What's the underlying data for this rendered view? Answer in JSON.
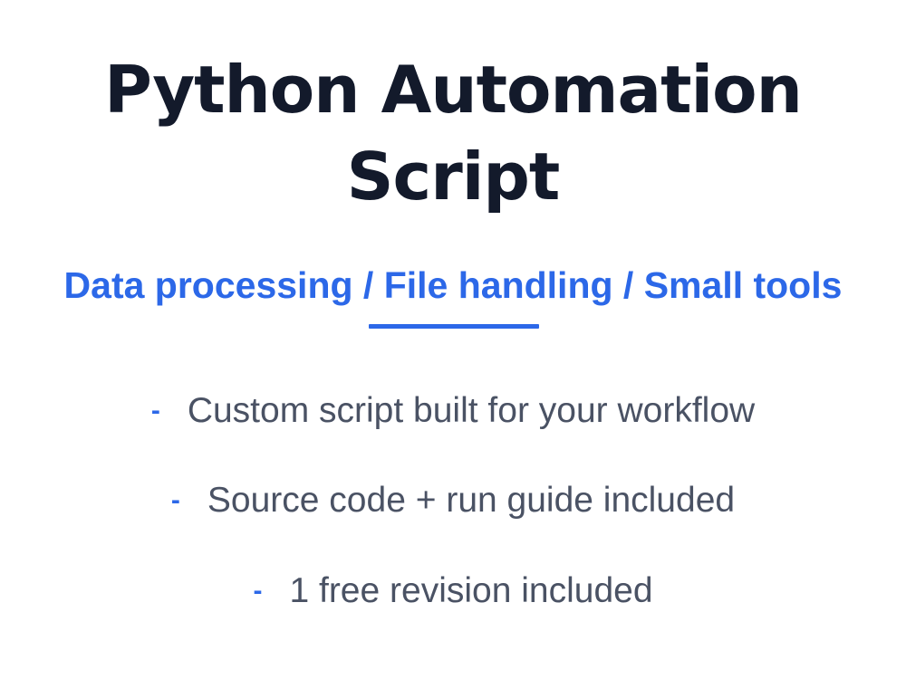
{
  "header": {
    "title_line1": "Python Automation",
    "title_line2": "Script",
    "subtitle": "Data processing / File handling / Small tools"
  },
  "features": {
    "bullet": "-",
    "items": [
      "Custom script built for your workflow",
      "Source code + run guide included",
      "1 free revision included"
    ]
  },
  "colors": {
    "title": "#131a2b",
    "accent": "#2c68e8",
    "body_text": "#4a5264",
    "background": "#ffffff"
  }
}
